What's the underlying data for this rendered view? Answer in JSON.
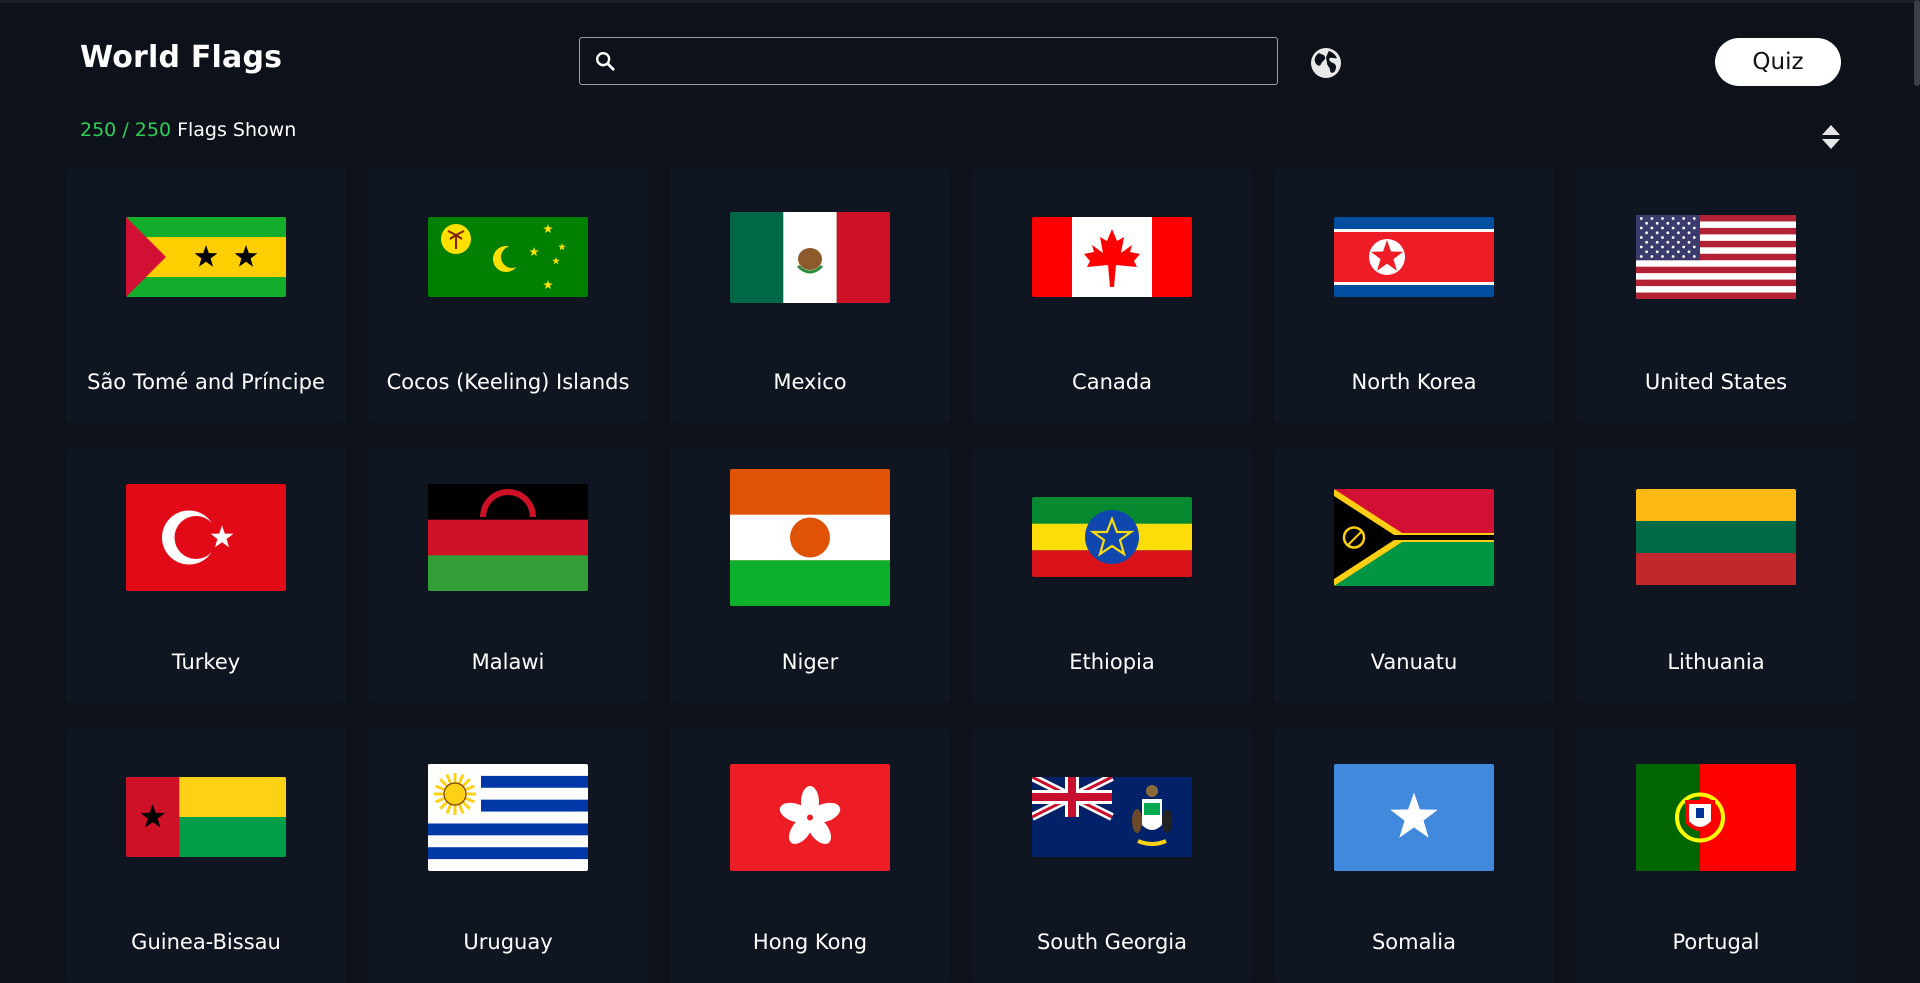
{
  "header": {
    "title": "World Flags",
    "search_placeholder": "",
    "search_icon": "search-icon",
    "globe_icon": "globe-icon",
    "quiz_label": "Quiz"
  },
  "stats": {
    "shown": "250",
    "separator": "/",
    "total": "250",
    "suffix": "Flags Shown"
  },
  "sort_icon": "sort-icon",
  "colors": {
    "background": "#0d1119",
    "card": "#0f1521",
    "count_green": "#2fce5a"
  },
  "flags": [
    {
      "name": "São Tomé and Príncipe",
      "key": "st"
    },
    {
      "name": "Cocos (Keeling) Islands",
      "key": "cc"
    },
    {
      "name": "Mexico",
      "key": "mx"
    },
    {
      "name": "Canada",
      "key": "ca"
    },
    {
      "name": "North Korea",
      "key": "kp"
    },
    {
      "name": "United States",
      "key": "us"
    },
    {
      "name": "Turkey",
      "key": "tr"
    },
    {
      "name": "Malawi",
      "key": "mw"
    },
    {
      "name": "Niger",
      "key": "ne"
    },
    {
      "name": "Ethiopia",
      "key": "et"
    },
    {
      "name": "Vanuatu",
      "key": "vu"
    },
    {
      "name": "Lithuania",
      "key": "lt"
    },
    {
      "name": "Guinea-Bissau",
      "key": "gw"
    },
    {
      "name": "Uruguay",
      "key": "uy"
    },
    {
      "name": "Hong Kong",
      "key": "hk"
    },
    {
      "name": "South Georgia",
      "key": "gs"
    },
    {
      "name": "Somalia",
      "key": "so"
    },
    {
      "name": "Portugal",
      "key": "pt"
    }
  ]
}
